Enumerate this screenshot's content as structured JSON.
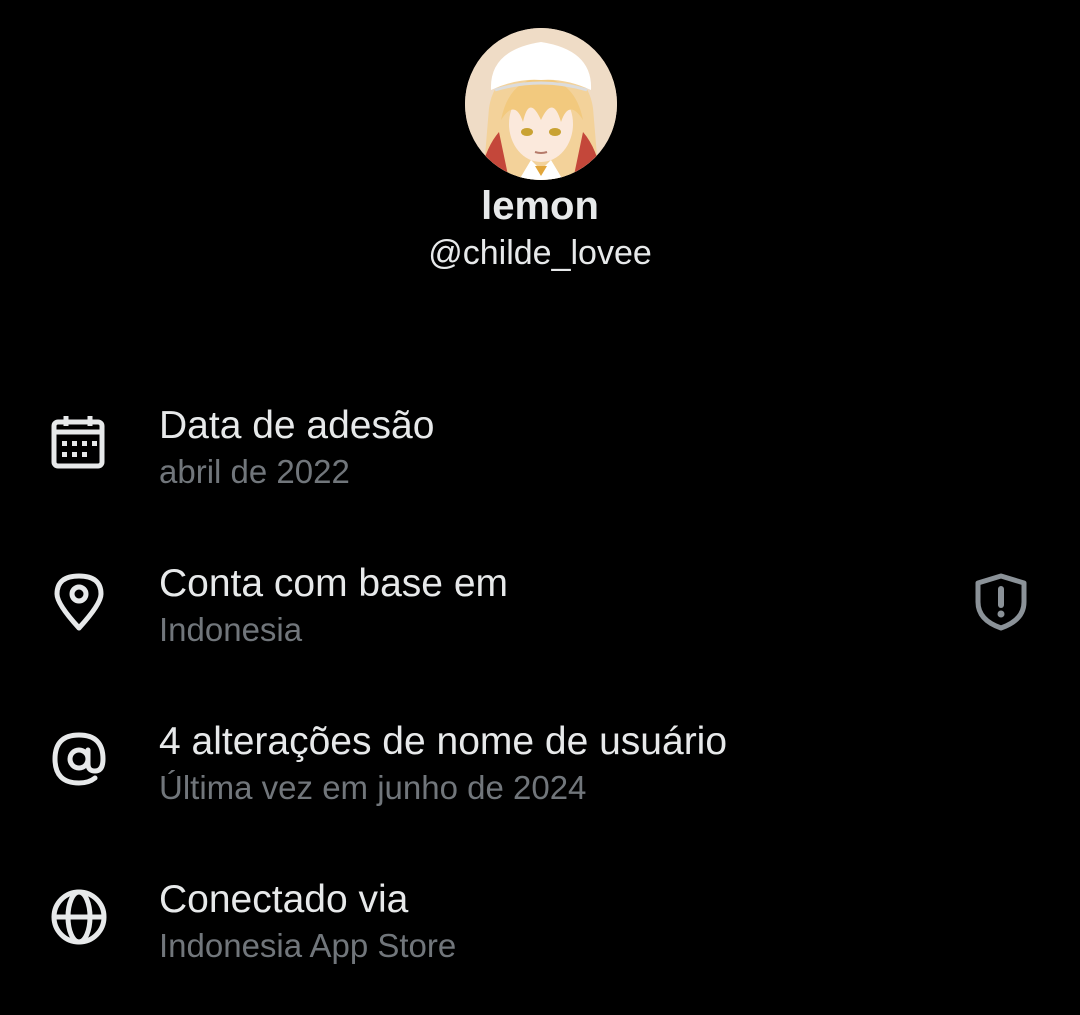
{
  "profile": {
    "display_name": "lemon",
    "handle": "@childe_lovee",
    "avatar_icon": "anime-character-avatar"
  },
  "rows": [
    {
      "icon": "calendar-icon",
      "title": "Data de adesão",
      "subtitle": "abril de 2022"
    },
    {
      "icon": "location-pin-icon",
      "title": "Conta com base em",
      "subtitle": "Indonesia",
      "trailing_icon": "shield-alert-icon"
    },
    {
      "icon": "at-sign-icon",
      "title": "4 alterações de nome de usuário",
      "subtitle": "Última vez em junho de 2024"
    },
    {
      "icon": "globe-icon",
      "title": "Conectado via",
      "subtitle": "Indonesia App Store"
    }
  ],
  "colors": {
    "background": "#000000",
    "primary_text": "#e7e9ea",
    "secondary_text": "#71767b"
  }
}
